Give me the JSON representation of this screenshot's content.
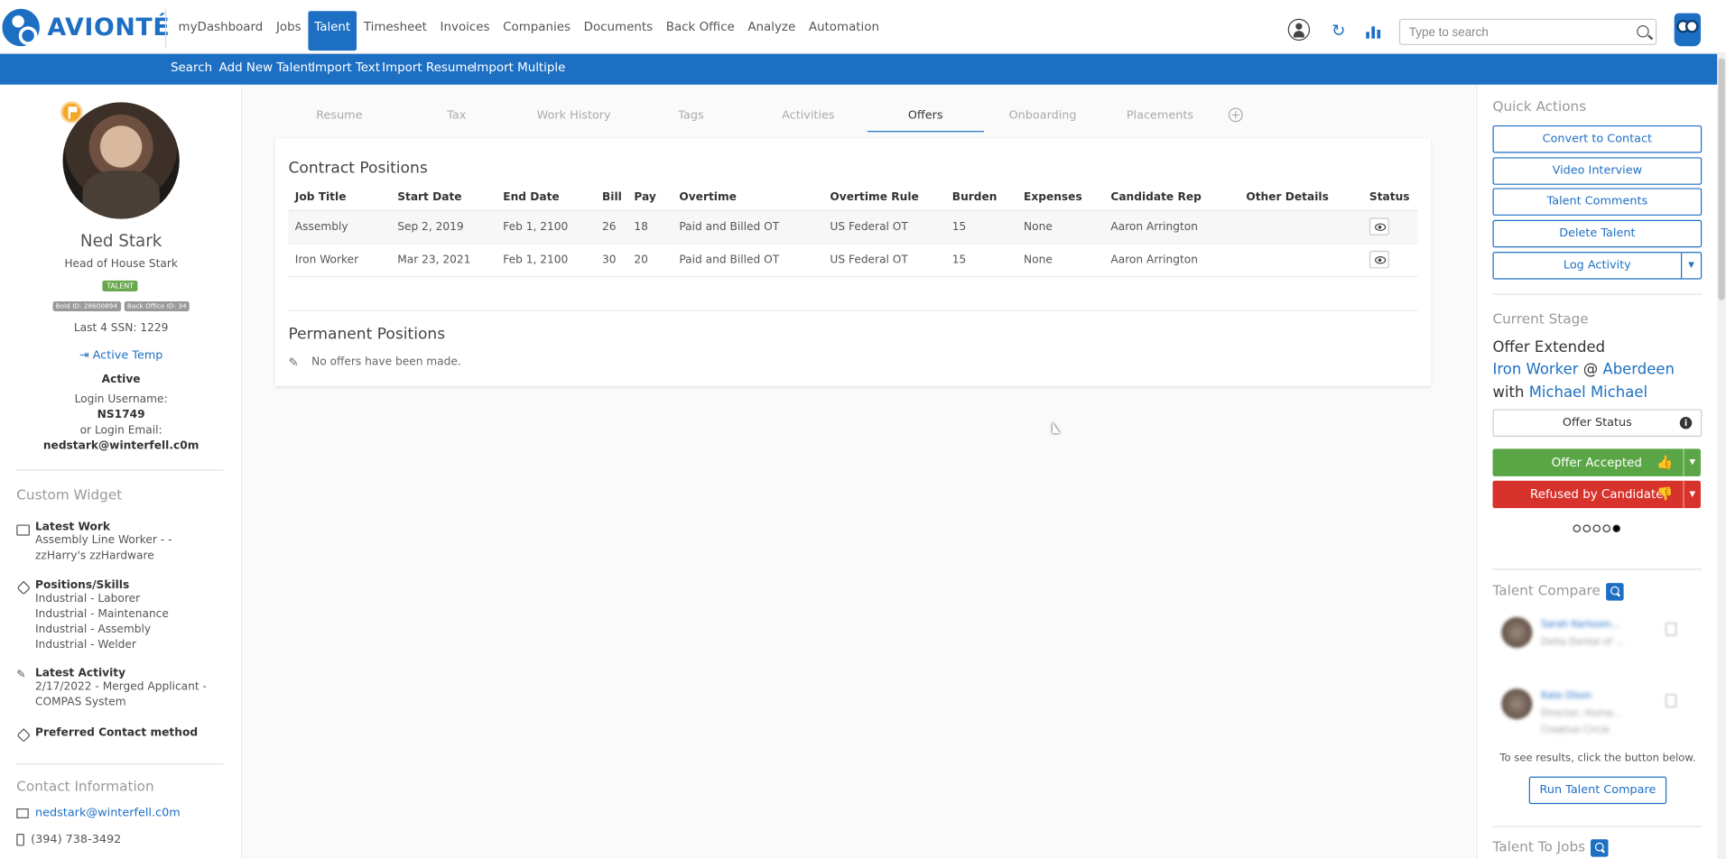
{
  "brand": {
    "name": "AVIONTÉ"
  },
  "nav": [
    "myDashboard",
    "Jobs",
    "Talent",
    "Timesheet",
    "Invoices",
    "Companies",
    "Documents",
    "Back Office",
    "Analyze",
    "Automation"
  ],
  "search": {
    "placeholder": "Type to search"
  },
  "subnav": [
    "Search",
    "Add New Talent",
    "Import Text",
    "Import Resume",
    "Import Multiple"
  ],
  "profile": {
    "name": "Ned Stark",
    "title": "Head of House Stark",
    "badge": "TALENT",
    "bold_id": "Bold ID: 28600894",
    "back_office_id": "Back Office ID: 34",
    "ssn": "Last 4 SSN: 1229",
    "status_link": "Active Temp",
    "status": "Active",
    "login_label": "Login Username:",
    "login_value": "NS1749",
    "email_label": "or Login Email:",
    "email_value": "nedstark@winterfell.c0m"
  },
  "widget": {
    "heading": "Custom Widget",
    "latest_work_title": "Latest Work",
    "latest_work_lines": [
      "Assembly Line Worker - -",
      "zzHarry's zzHardware"
    ],
    "skills_title": "Positions/Skills",
    "skills_lines": [
      "Industrial - Laborer",
      "Industrial - Maintenance",
      "Industrial - Assembly",
      "Industrial - Welder"
    ],
    "activity_title": "Latest Activity",
    "activity_lines": [
      "2/17/2022 - Merged Applicant -",
      "COMPAS System"
    ],
    "contact_method_title": "Preferred Contact method"
  },
  "contact": {
    "heading": "Contact Information",
    "email": "nedstark@winterfell.c0m",
    "phone": "(394) 738-3492"
  },
  "tabs": [
    "Resume",
    "Tax",
    "Work History",
    "Tags",
    "Activities",
    "Offers",
    "Onboarding",
    "Placements"
  ],
  "active_tab": "Offers",
  "contract": {
    "heading": "Contract Positions",
    "columns": [
      "Job Title",
      "Start Date",
      "End Date",
      "Bill",
      "Pay",
      "Overtime",
      "Overtime Rule",
      "Burden",
      "Expenses",
      "Candidate Rep",
      "Other Details",
      "Status"
    ],
    "rows": [
      [
        "Assembly",
        "Sep 2, 2019",
        "Feb 1, 2100",
        "26",
        "18",
        "Paid and Billed OT",
        "US Federal OT",
        "15",
        "None",
        "Aaron Arrington",
        ""
      ],
      [
        "Iron Worker",
        "Mar 23, 2021",
        "Feb 1, 2100",
        "30",
        "20",
        "Paid and Billed OT",
        "US Federal OT",
        "15",
        "None",
        "Aaron Arrington",
        ""
      ]
    ]
  },
  "permanent": {
    "heading": "Permanent Positions",
    "empty": "No offers have been made."
  },
  "quick_actions": {
    "heading": "Quick Actions",
    "buttons": [
      "Convert to Contact",
      "Video Interview",
      "Talent Comments",
      "Delete Talent",
      "Log Activity"
    ]
  },
  "stage": {
    "heading": "Current Stage",
    "line1": "Offer Extended",
    "job": "Iron Worker",
    "at": "@",
    "company": "Aberdeen",
    "with": "with",
    "contact": "Michael Michael",
    "offer_status": "Offer Status",
    "accepted": "Offer Accepted",
    "refused": "Refused by Candidate",
    "progress_step": 5,
    "progress_total": 5
  },
  "compare": {
    "heading": "Talent Compare",
    "note": "To see results, click the button below.",
    "run_button": "Run Talent Compare",
    "items": [
      {
        "name": "Sarah Karlsson...",
        "sub1": "Delta Dental of ..."
      },
      {
        "name": "Kate Olson",
        "sub1": "Director, Huma...",
        "sub2": "Creative Circle"
      }
    ]
  },
  "talent_to_jobs": {
    "heading": "Talent To Jobs"
  },
  "colors": {
    "brand": "#1d6fc4",
    "accept": "#5aa646",
    "refuse": "#d8322c"
  }
}
